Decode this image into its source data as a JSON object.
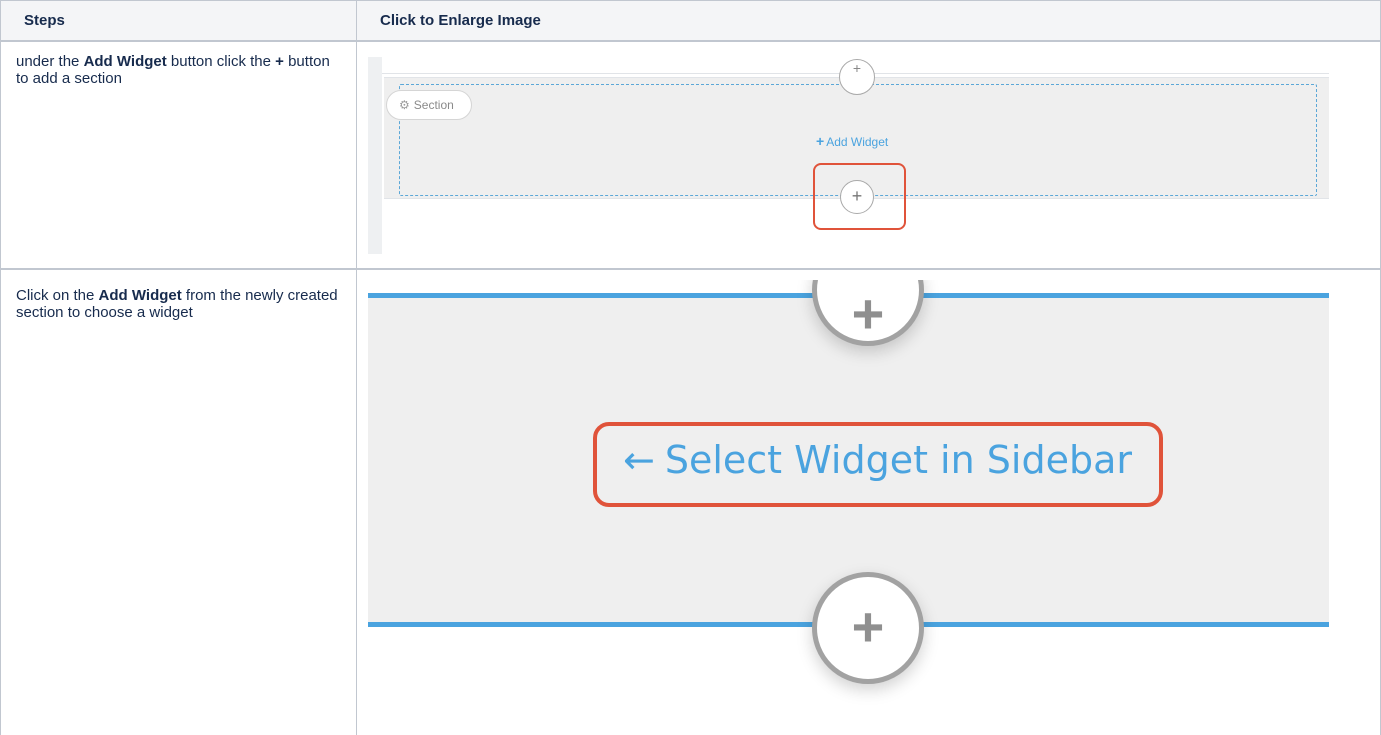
{
  "table": {
    "headers": {
      "steps": "Steps",
      "image": "Click to Enlarge Image"
    },
    "rows": [
      {
        "step_parts": [
          "under the ",
          "Add Widget",
          " button click the ",
          "+",
          " button to add a section"
        ],
        "image": {
          "section_pill": "Section",
          "add_widget": "Add Widget",
          "plus_symbol": "+"
        }
      },
      {
        "step_parts": [
          "Click on the ",
          "Add Widget",
          " from the newly created section to choose a widget"
        ],
        "image": {
          "select_widget": "Select Widget in Sidebar",
          "plus_symbol": "+",
          "arrow_symbol": "←"
        }
      }
    ]
  },
  "colors": {
    "header_bg": "#f4f5f7",
    "border": "#c1c7d0",
    "accent_blue": "#4aa3df",
    "highlight_red": "#e0533a",
    "section_grey": "#efefef"
  },
  "icons": [
    "gear-icon",
    "plus-icon",
    "arrow-left-icon"
  ]
}
